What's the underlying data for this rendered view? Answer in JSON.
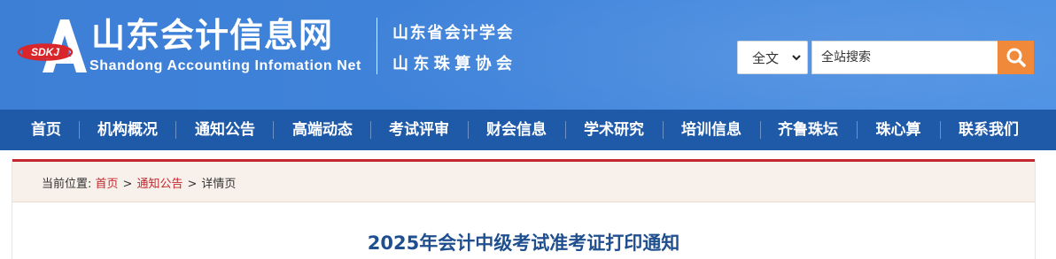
{
  "header": {
    "logo_text": "SDKJ",
    "site_title": "山东会计信息网",
    "site_subtitle": "Shandong Accounting Infomation Net",
    "org_line1": "山东省会计学会",
    "org_line2": "山东珠算协会"
  },
  "search": {
    "scope_selected": "全文",
    "placeholder": "全站搜索",
    "button_icon": "search-icon",
    "button_color": "#f08a3a"
  },
  "nav": {
    "items": [
      "首页",
      "机构概况",
      "通知公告",
      "高端动态",
      "考试评审",
      "财会信息",
      "学术研究",
      "培训信息",
      "齐鲁珠坛",
      "珠心算",
      "联系我们"
    ]
  },
  "breadcrumb": {
    "prefix": "当前位置:",
    "items": [
      "首页",
      "通知公告",
      "详情页"
    ],
    "separator": ">"
  },
  "article": {
    "title": "2025年会计中级考试准考证打印通知"
  },
  "colors": {
    "header_blue": "#3f83da",
    "nav_blue": "#1f5aa8",
    "accent_red": "#c1272d",
    "title_blue": "#1f4f8f"
  }
}
